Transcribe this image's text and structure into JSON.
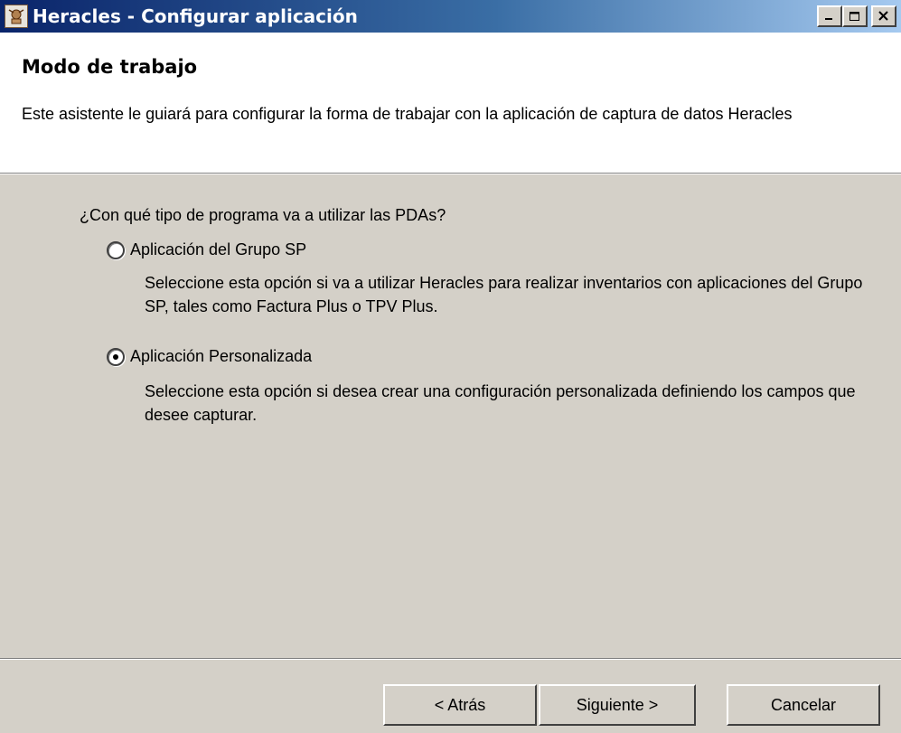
{
  "window": {
    "title": "Heracles - Configurar aplicación",
    "icon": "heracles-app-icon"
  },
  "header": {
    "title": "Modo de trabajo",
    "description": "Este asistente le guiará para configurar la forma de trabajar con la aplicación de captura de datos Heracles"
  },
  "body": {
    "question": "¿Con qué tipo de programa va a utilizar las PDAs?",
    "options": [
      {
        "label": "Aplicación del Grupo SP",
        "description": "Seleccione esta opción si va a utilizar Heracles para realizar inventarios con aplicaciones del Grupo SP, tales como Factura Plus o TPV Plus.",
        "selected": false
      },
      {
        "label": "Aplicación Personalizada",
        "description": "Seleccione esta opción si desea crear una configuración personalizada definiendo los campos que desee capturar.",
        "selected": true
      }
    ]
  },
  "buttons": {
    "back": "< Atrás",
    "next": "Siguiente >",
    "cancel": "Cancelar"
  },
  "colors": {
    "title_gradient_start": "#0a246a",
    "title_gradient_end": "#a6caf0",
    "dialog_face": "#d4d0c8",
    "header_bg": "#ffffff"
  }
}
